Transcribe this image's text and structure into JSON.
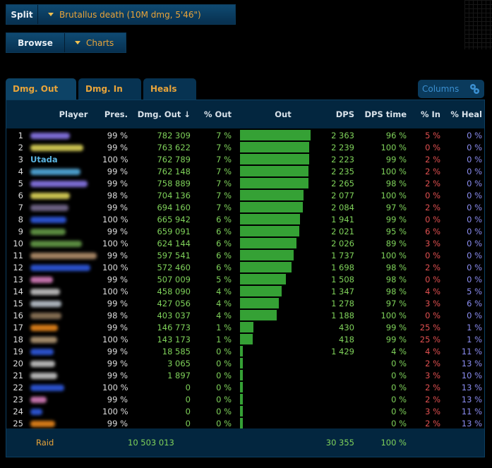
{
  "toolbar": {
    "split": {
      "label": "Split",
      "dropdown": "Brutallus death   (10M dmg, 5'46\")"
    },
    "browse": {
      "label": "Browse",
      "dropdown": "Charts"
    }
  },
  "tabs": [
    {
      "label": "Dmg. Out",
      "active": true
    },
    {
      "label": "Dmg. In",
      "active": false
    },
    {
      "label": "Heals",
      "active": false
    }
  ],
  "columns_button": {
    "label": "Columns",
    "icon": "gears-icon"
  },
  "table": {
    "headers": {
      "player": "Player",
      "presence": "Pres.",
      "dmg_out": "Dmg. Out ↓",
      "pct_out": "% Out",
      "out": "Out",
      "dps": "DPS",
      "dps_time": "DPS time",
      "pct_in": "% In",
      "pct_heal": "% Heal"
    },
    "rows": [
      {
        "rank": "1",
        "name": "",
        "name_color": "#7a6ad0",
        "name_len": 75,
        "pres": "99 %",
        "dmg": "782 309",
        "pct": "7 %",
        "bar": 1.0,
        "dps": "2 363",
        "dps_time": "96 %",
        "pct_in": "5 %",
        "pct_heal": "0 %"
      },
      {
        "rank": "2",
        "name": "",
        "name_color": "#c8c050",
        "name_len": 100,
        "pres": "99 %",
        "dmg": "763 622",
        "pct": "7 %",
        "bar": 0.976,
        "dps": "2 239",
        "dps_time": "100 %",
        "pct_in": "0 %",
        "pct_heal": "0 %"
      },
      {
        "rank": "3",
        "name": "Utada",
        "name_color": "#5ab4e0",
        "name_len": 0,
        "pres": "100 %",
        "dmg": "762 789",
        "pct": "7 %",
        "bar": 0.975,
        "dps": "2 223",
        "dps_time": "99 %",
        "pct_in": "2 %",
        "pct_heal": "0 %"
      },
      {
        "rank": "4",
        "name": "",
        "name_color": "#4a9ac8",
        "name_len": 95,
        "pres": "99 %",
        "dmg": "762 148",
        "pct": "7 %",
        "bar": 0.974,
        "dps": "2 235",
        "dps_time": "100 %",
        "pct_in": "2 %",
        "pct_heal": "0 %"
      },
      {
        "rank": "5",
        "name": "",
        "name_color": "#7a6ad0",
        "name_len": 108,
        "pres": "99 %",
        "dmg": "758 889",
        "pct": "7 %",
        "bar": 0.97,
        "dps": "2 265",
        "dps_time": "98 %",
        "pct_in": "2 %",
        "pct_heal": "0 %"
      },
      {
        "rank": "6",
        "name": "",
        "name_color": "#c8c050",
        "name_len": 75,
        "pres": "98 %",
        "dmg": "704 136",
        "pct": "7 %",
        "bar": 0.9,
        "dps": "2 077",
        "dps_time": "100 %",
        "pct_in": "0 %",
        "pct_heal": "0 %"
      },
      {
        "rank": "7",
        "name": "",
        "name_color": "#6a6080",
        "name_len": 72,
        "pres": "99 %",
        "dmg": "694 160",
        "pct": "7 %",
        "bar": 0.887,
        "dps": "2 084",
        "dps_time": "97 %",
        "pct_in": "2 %",
        "pct_heal": "0 %"
      },
      {
        "rank": "8",
        "name": "",
        "name_color": "#2a50c8",
        "name_len": 68,
        "pres": "100 %",
        "dmg": "665 942",
        "pct": "6 %",
        "bar": 0.851,
        "dps": "1 941",
        "dps_time": "99 %",
        "pct_in": "0 %",
        "pct_heal": "0 %"
      },
      {
        "rank": "9",
        "name": "",
        "name_color": "#5a8a40",
        "name_len": 66,
        "pres": "99 %",
        "dmg": "659 091",
        "pct": "6 %",
        "bar": 0.842,
        "dps": "2 021",
        "dps_time": "95 %",
        "pct_in": "6 %",
        "pct_heal": "0 %"
      },
      {
        "rank": "10",
        "name": "",
        "name_color": "#5a8a40",
        "name_len": 97,
        "pres": "100 %",
        "dmg": "624 144",
        "pct": "6 %",
        "bar": 0.798,
        "dps": "2 026",
        "dps_time": "89 %",
        "pct_in": "3 %",
        "pct_heal": "0 %"
      },
      {
        "rank": "11",
        "name": "",
        "name_color": "#a08060",
        "name_len": 125,
        "pres": "99 %",
        "dmg": "597 541",
        "pct": "6 %",
        "bar": 0.764,
        "dps": "1 737",
        "dps_time": "100 %",
        "pct_in": "0 %",
        "pct_heal": "0 %"
      },
      {
        "rank": "12",
        "name": "",
        "name_color": "#2a50c8",
        "name_len": 113,
        "pres": "100 %",
        "dmg": "572 460",
        "pct": "6 %",
        "bar": 0.732,
        "dps": "1 698",
        "dps_time": "98 %",
        "pct_in": "2 %",
        "pct_heal": "0 %"
      },
      {
        "rank": "13",
        "name": "",
        "name_color": "#c070a8",
        "name_len": 42,
        "pres": "99 %",
        "dmg": "507 009",
        "pct": "5 %",
        "bar": 0.648,
        "dps": "1 508",
        "dps_time": "98 %",
        "pct_in": "0 %",
        "pct_heal": "0 %"
      },
      {
        "rank": "14",
        "name": "",
        "name_color": "#b0b0b0",
        "name_len": 56,
        "pres": "100 %",
        "dmg": "458 090",
        "pct": "4 %",
        "bar": 0.586,
        "dps": "1 347",
        "dps_time": "98 %",
        "pct_in": "4 %",
        "pct_heal": "5 %"
      },
      {
        "rank": "15",
        "name": "",
        "name_color": "#a8b0b8",
        "name_len": 58,
        "pres": "99 %",
        "dmg": "427 056",
        "pct": "4 %",
        "bar": 0.546,
        "dps": "1 278",
        "dps_time": "97 %",
        "pct_in": "3 %",
        "pct_heal": "6 %"
      },
      {
        "rank": "16",
        "name": "",
        "name_color": "#806a50",
        "name_len": 58,
        "pres": "98 %",
        "dmg": "403 037",
        "pct": "4 %",
        "bar": 0.515,
        "dps": "1 188",
        "dps_time": "100 %",
        "pct_in": "0 %",
        "pct_heal": "0 %"
      },
      {
        "rank": "17",
        "name": "",
        "name_color": "#d07818",
        "name_len": 52,
        "pres": "99 %",
        "dmg": "146 773",
        "pct": "1 %",
        "bar": 0.188,
        "dps": "430",
        "dps_time": "99 %",
        "pct_in": "25 %",
        "pct_heal": "1 %"
      },
      {
        "rank": "18",
        "name": "",
        "name_color": "#a08868",
        "name_len": 50,
        "pres": "100 %",
        "dmg": "143 173",
        "pct": "1 %",
        "bar": 0.183,
        "dps": "418",
        "dps_time": "99 %",
        "pct_in": "25 %",
        "pct_heal": "1 %"
      },
      {
        "rank": "19",
        "name": "",
        "name_color": "#2a50c8",
        "name_len": 44,
        "pres": "99 %",
        "dmg": "18 585",
        "pct": "0 %",
        "bar": 0.024,
        "dps": "1 429",
        "dps_time": "4 %",
        "pct_in": "4 %",
        "pct_heal": "11 %"
      },
      {
        "rank": "20",
        "name": "",
        "name_color": "#b0b0b0",
        "name_len": 46,
        "pres": "99 %",
        "dmg": "3 065",
        "pct": "0 %",
        "bar": 0.004,
        "dps": "",
        "dps_time": "0 %",
        "pct_in": "2 %",
        "pct_heal": "13 %"
      },
      {
        "rank": "21",
        "name": "",
        "name_color": "#b0b0b0",
        "name_len": 50,
        "pres": "99 %",
        "dmg": "1 897",
        "pct": "0 %",
        "bar": 0.002,
        "dps": "",
        "dps_time": "0 %",
        "pct_in": "3 %",
        "pct_heal": "10 %"
      },
      {
        "rank": "22",
        "name": "",
        "name_color": "#2a50c8",
        "name_len": 64,
        "pres": "100 %",
        "dmg": "0",
        "pct": "0 %",
        "bar": 0,
        "dps": "",
        "dps_time": "0 %",
        "pct_in": "2 %",
        "pct_heal": "13 %"
      },
      {
        "rank": "23",
        "name": "",
        "name_color": "#c070a8",
        "name_len": 30,
        "pres": "99 %",
        "dmg": "0",
        "pct": "0 %",
        "bar": 0,
        "dps": "",
        "dps_time": "0 %",
        "pct_in": "2 %",
        "pct_heal": "13 %"
      },
      {
        "rank": "24",
        "name": "",
        "name_color": "#2a50c8",
        "name_len": 22,
        "pres": "100 %",
        "dmg": "0",
        "pct": "0 %",
        "bar": 0,
        "dps": "",
        "dps_time": "0 %",
        "pct_in": "3 %",
        "pct_heal": "11 %"
      },
      {
        "rank": "25",
        "name": "",
        "name_color": "#d07818",
        "name_len": 46,
        "pres": "99 %",
        "dmg": "0",
        "pct": "0 %",
        "bar": 0,
        "dps": "",
        "dps_time": "0 %",
        "pct_in": "2 %",
        "pct_heal": "13 %"
      }
    ],
    "footer": {
      "label": "Raid",
      "dmg": "10 503 013",
      "dps": "30 355",
      "dps_time": "100 %"
    }
  }
}
